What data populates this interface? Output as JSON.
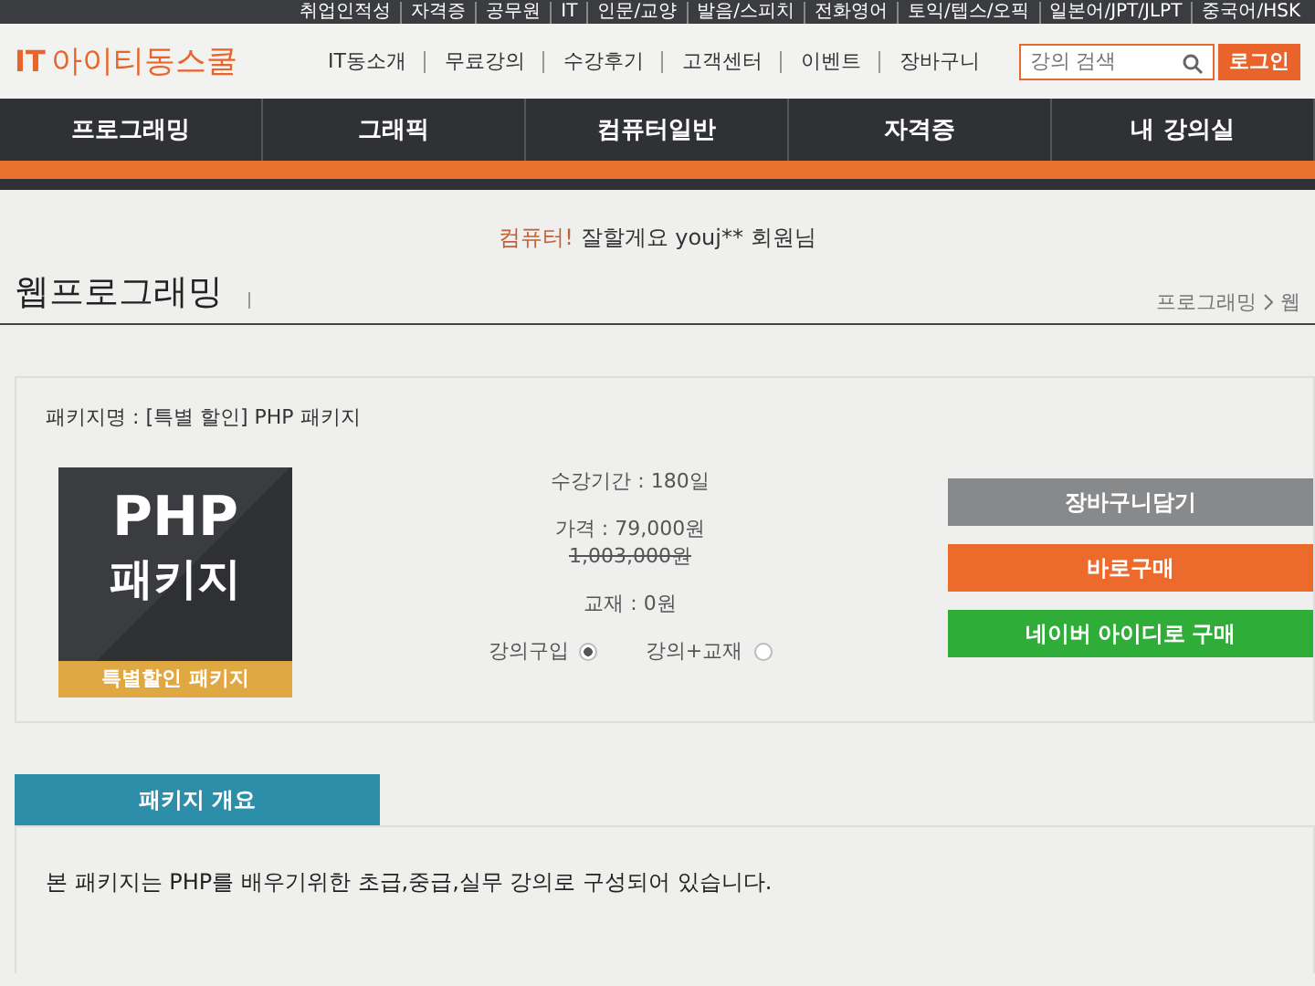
{
  "top_links": [
    "취업인적성",
    "자격증",
    "공무원",
    "IT",
    "인문/교양",
    "발음/스피치",
    "전화영어",
    "토익/텝스/오픽",
    "일본어/JPT/JLPT",
    "중국어/HSK"
  ],
  "logo": {
    "mark": "IT",
    "text": "아이티동스쿨"
  },
  "header_links": [
    "IT동소개",
    "무료강의",
    "수강후기",
    "고객센터",
    "이벤트",
    "장바구니"
  ],
  "search": {
    "placeholder": "강의 검색"
  },
  "login_button": "로그인",
  "nav": [
    "프로그래밍",
    "그래픽",
    "컴퓨터일반",
    "자격증",
    "내 강의실"
  ],
  "greeting": {
    "slogan": "컴퓨터!",
    "text": "잘할게요 youj** 회원님"
  },
  "page_title": "웹프로그래밍",
  "breadcrumb": [
    "프로그래밍",
    "웹"
  ],
  "package": {
    "name": "패키지명 : [특별 할인] PHP 패키지",
    "thumbnail": {
      "title": "PHP",
      "subtitle": "패키지",
      "ribbon": "특별할인 패키지"
    },
    "period": "수강기간 : 180일",
    "price": "가격 : 79,000원",
    "original_price": "1,003,000원",
    "book": "교재 : 0원",
    "options": [
      {
        "label": "강의구입",
        "selected": true
      },
      {
        "label": "강의+교재",
        "selected": false
      }
    ],
    "buttons": [
      {
        "label": "장바구니담기",
        "kind": "cart"
      },
      {
        "label": "바로구매",
        "kind": "buy"
      },
      {
        "label": "네이버 아이디로 구매",
        "kind": "naver"
      }
    ]
  },
  "overview": {
    "tab": "패키지 개요",
    "text": "본 패키지는 PHP를 배우기위한 초급,중급,실무 강의로 구성되어 있습니다."
  }
}
